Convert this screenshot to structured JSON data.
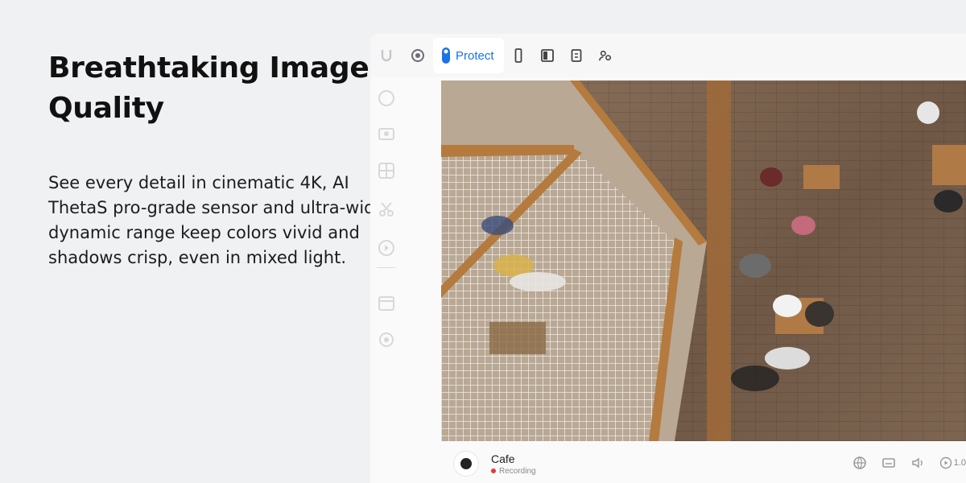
{
  "hero": {
    "title": "Breathtaking Image Quality",
    "description": "See every detail in cinematic 4K, AI ThetaS pro-grade sensor and ultra-wide dynamic range keep colors vivid and shadows crisp, even in mixed light."
  },
  "app": {
    "topbar": {
      "protect_label": "Protect",
      "icons": [
        "ubiquiti-logo-icon",
        "circle-target-icon",
        "protect-camera-icon",
        "phone-icon",
        "book-icon",
        "document-icon",
        "user-settings-icon"
      ]
    },
    "sidebar_icons": [
      "shield-icon",
      "camera-icon",
      "grid-icon",
      "scissors-icon",
      "play-circle-icon",
      "calendar-icon",
      "settings-icon"
    ],
    "camera": {
      "name": "Cafe",
      "status": "Recording"
    },
    "controls": {
      "speed": "1.0"
    },
    "colors": {
      "accent": "#1a73e8",
      "recording": "#e53935",
      "background": "#f0f1f3"
    }
  }
}
